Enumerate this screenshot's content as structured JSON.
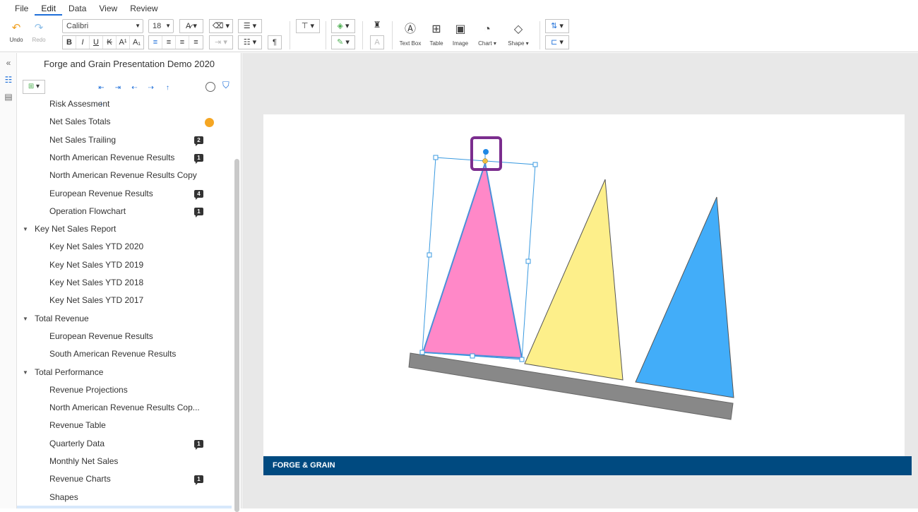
{
  "menu": [
    "File",
    "Edit",
    "Data",
    "View",
    "Review"
  ],
  "menu_active": "Edit",
  "toolbar": {
    "undo_label": "Undo",
    "redo_label": "Redo",
    "font_name": "Calibri",
    "font_size": "18",
    "text_box_label": "Text Box",
    "table_label": "Table",
    "image_label": "Image",
    "chart_label": "Chart",
    "shape_label": "Shape"
  },
  "document": {
    "title": "Forge and Grain Presentation Demo 2020"
  },
  "outline": [
    {
      "label": "Risk Assesment",
      "level": 1
    },
    {
      "label": "Net Sales Totals",
      "level": 1,
      "dot": true
    },
    {
      "label": "Net Sales Trailing",
      "level": 1,
      "badge": "2"
    },
    {
      "label": "North American Revenue Results",
      "level": 1,
      "badge": "1"
    },
    {
      "label": "North American Revenue Results Copy",
      "level": 1
    },
    {
      "label": "European Revenue Results",
      "level": 1,
      "badge": "4"
    },
    {
      "label": "Operation Flowchart",
      "level": 1,
      "badge": "1"
    },
    {
      "label": "Key Net Sales Report",
      "level": 0
    },
    {
      "label": "Key Net Sales YTD 2020",
      "level": 1
    },
    {
      "label": "Key Net Sales YTD 2019",
      "level": 1
    },
    {
      "label": "Key Net Sales YTD 2018",
      "level": 1
    },
    {
      "label": "Key Net Sales YTD 2017",
      "level": 1
    },
    {
      "label": "Total Revenue",
      "level": 0
    },
    {
      "label": "European Revenue Results",
      "level": 1
    },
    {
      "label": "South American Revenue Results",
      "level": 1
    },
    {
      "label": "Total Performance",
      "level": 0
    },
    {
      "label": "Revenue Projections",
      "level": 1
    },
    {
      "label": "North American Revenue Results Cop...",
      "level": 1
    },
    {
      "label": "Revenue Table",
      "level": 1
    },
    {
      "label": "Quarterly Data",
      "level": 1,
      "badge": "1"
    },
    {
      "label": "Monthly Net Sales",
      "level": 1
    },
    {
      "label": "Revenue Charts",
      "level": 1,
      "badge": "1"
    },
    {
      "label": "Shapes",
      "level": 1
    }
  ],
  "slide": {
    "footer_text": "FORGE & GRAIN"
  },
  "colors": {
    "accent": "#1e6fd9",
    "pink_triangle": "#ff88c8",
    "yellow_triangle": "#fdef8a",
    "blue_triangle": "#42adf9",
    "bar": "#888888",
    "footer": "#004a80",
    "highlight": "#7b2d8e"
  }
}
